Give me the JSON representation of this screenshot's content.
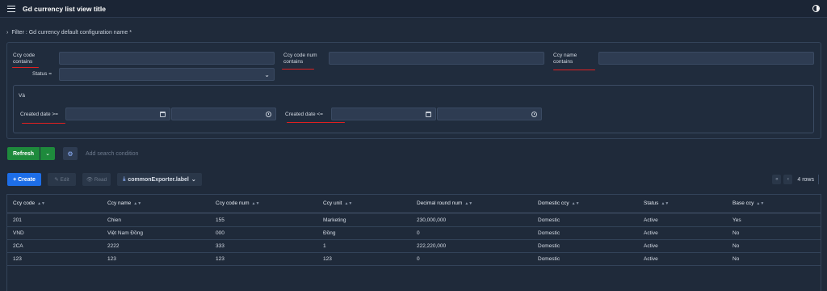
{
  "app": {
    "title": "Gd currency list view title"
  },
  "filter": {
    "header": "Filter : Gd currency default configuration name *",
    "ccy_code_label_1": "Ccy code",
    "ccy_code_label_2": "contains",
    "ccy_code_num_label_1": "Ccy code num",
    "ccy_code_num_label_2": "contains",
    "ccy_name_label_1": "Ccy name",
    "ccy_name_label_2": "contains",
    "status_label": "Status =",
    "status_value": "",
    "and_label": "Và",
    "created_from_label": "Created date >=",
    "created_to_label": "Created date <="
  },
  "toolbar": {
    "refresh": "Refresh",
    "add_condition": "Add search condition",
    "create": "+ Create",
    "edit": "✎ Edit",
    "read": "👁 Read",
    "export": "commonExporter.label"
  },
  "pager": {
    "rows": "4 rows"
  },
  "table": {
    "columns": [
      "Ccy code",
      "Ccy name",
      "Ccy code num",
      "Ccy unit",
      "Decimal round num",
      "Domestic ccy",
      "Status",
      "Base ccy"
    ],
    "rows": [
      [
        "201",
        "Chien",
        "155",
        "Marketing",
        "230,000,000",
        "Domestic",
        "Active",
        "Yes"
      ],
      [
        "VND",
        "Việt Nam Đồng",
        "000",
        "Đồng",
        "0",
        "Domestic",
        "Active",
        "No"
      ],
      [
        "2CA",
        "2222",
        "333",
        "1",
        "222,220,000",
        "Domestic",
        "Active",
        "No"
      ],
      [
        "123",
        "123",
        "123",
        "123",
        "0",
        "Domestic",
        "Active",
        "No"
      ]
    ]
  },
  "colors": {
    "accent": "#1d6ee8",
    "refresh": "#1e8a3c",
    "annotation": "#e02020",
    "background": "#1f2a3a"
  }
}
